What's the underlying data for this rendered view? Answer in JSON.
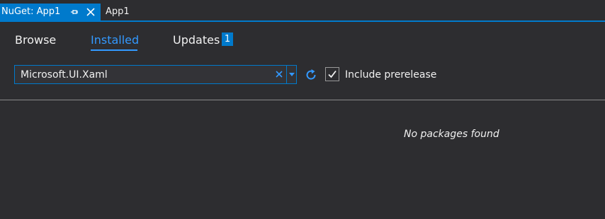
{
  "tabs": [
    {
      "title": "NuGet: App1",
      "active": true,
      "icons": [
        "pin-icon",
        "close-icon"
      ]
    },
    {
      "title": "App1",
      "active": false
    }
  ],
  "nav": {
    "browse": "Browse",
    "installed": "Installed",
    "updates": "Updates",
    "updates_count": "1",
    "selected": "Installed"
  },
  "search": {
    "value": "Microsoft.UI.Xaml",
    "icons": [
      "clear-icon",
      "chevron-down-icon"
    ]
  },
  "refresh_icon": "refresh-icon",
  "prerelease": {
    "label": "Include prerelease",
    "checked": true
  },
  "results": {
    "empty_message": "No packages found"
  },
  "colors": {
    "accent": "#007acc",
    "background": "#2d2d30",
    "selected_tab": "#3399ff",
    "text": "#f1f1f1"
  }
}
